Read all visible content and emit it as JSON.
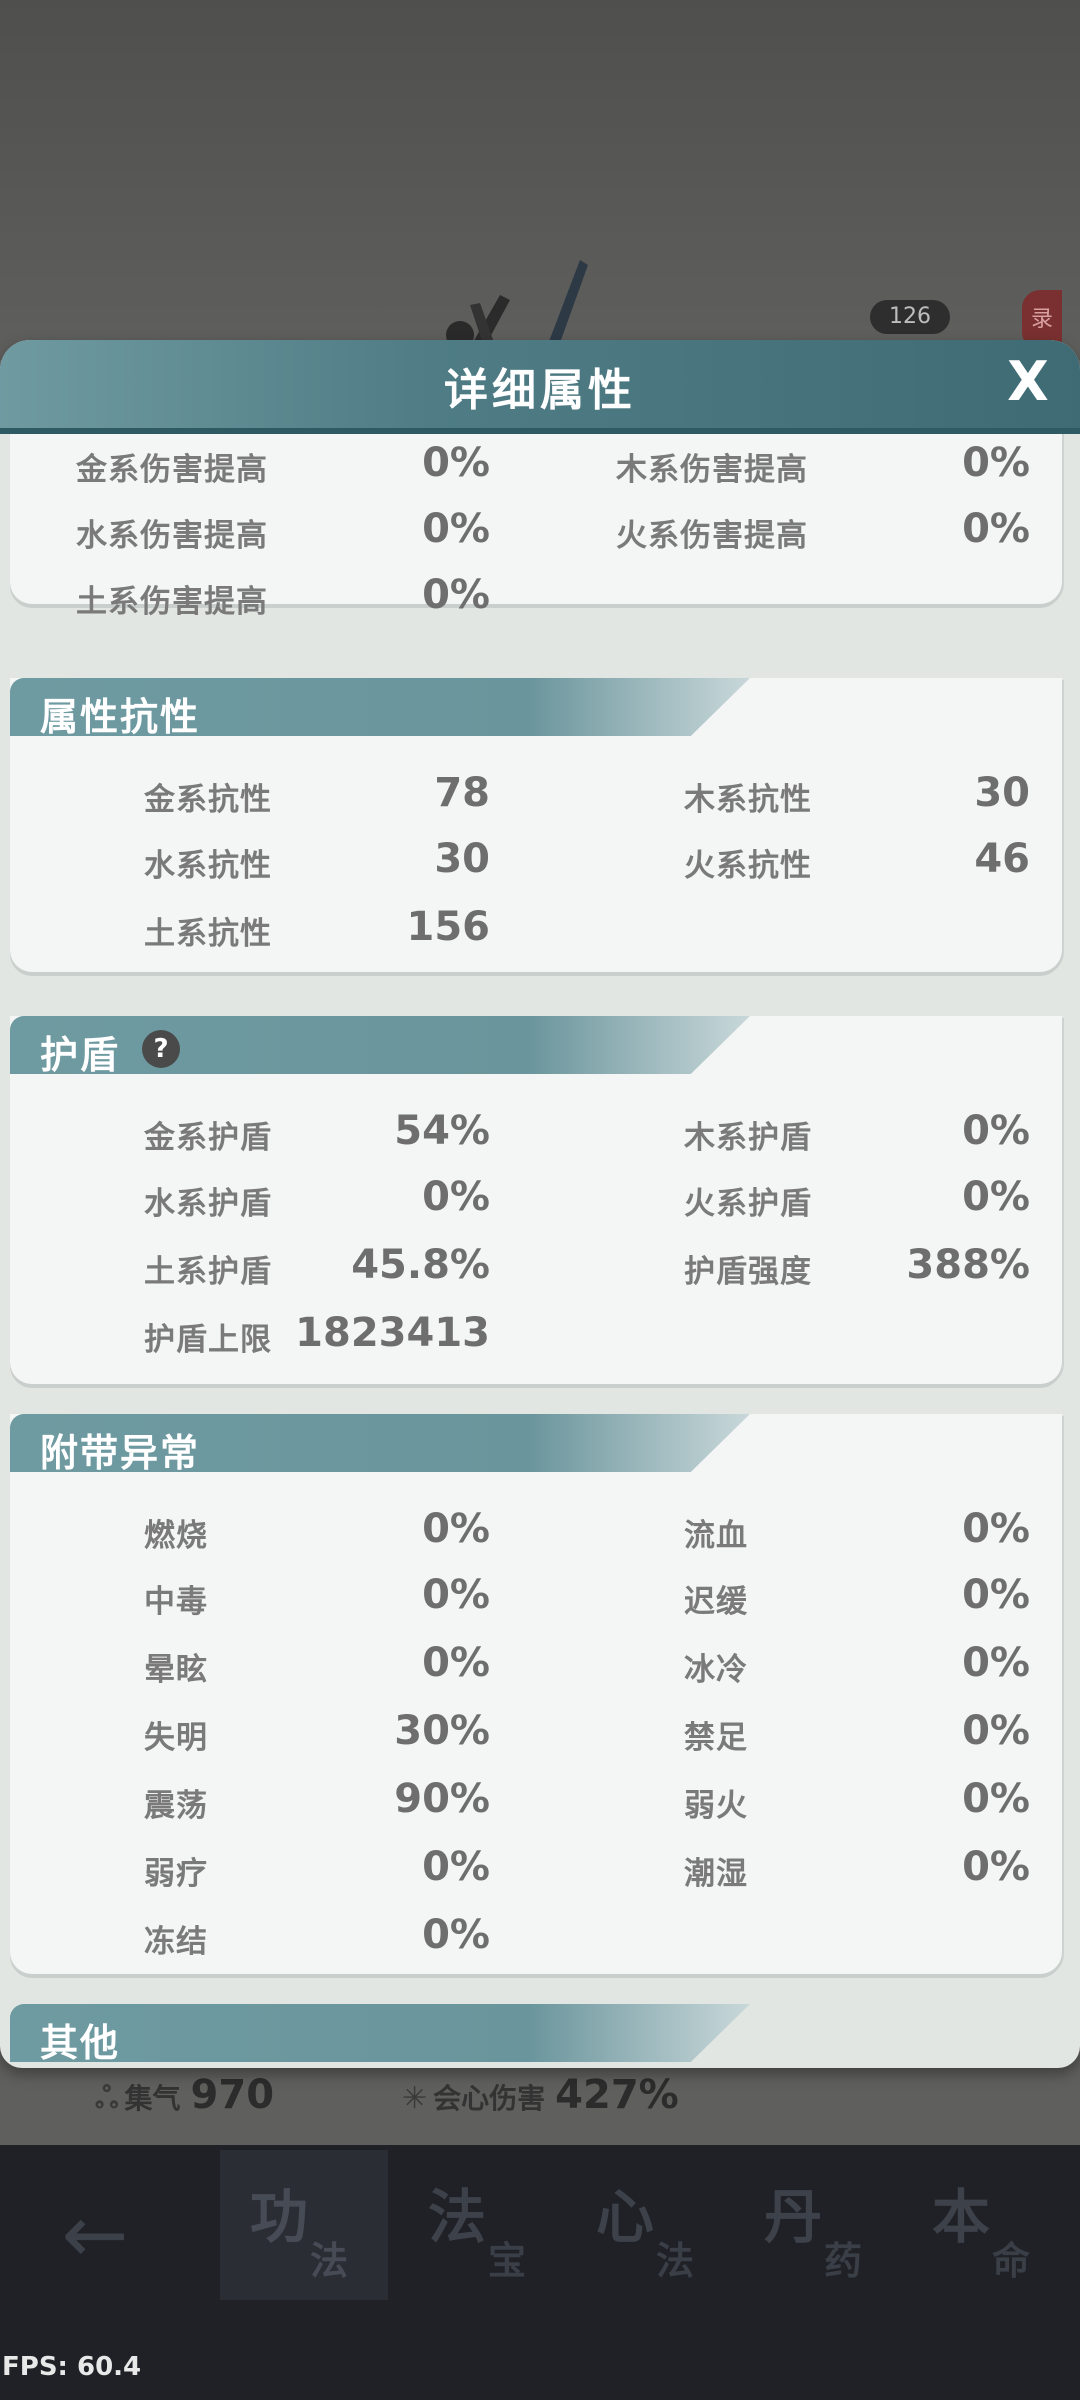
{
  "background": {
    "badge_number": "126",
    "side_tab": "录",
    "stats": [
      {
        "icon": "swirl-icon",
        "label": "集气",
        "value": "970"
      },
      {
        "icon": "crit-star-icon",
        "label": "会心伤害",
        "value": "427%"
      }
    ],
    "nav_tabs": [
      {
        "big": "功",
        "small": "法"
      },
      {
        "big": "法",
        "small": "宝"
      },
      {
        "big": "心",
        "small": "法"
      },
      {
        "big": "丹",
        "small": "药"
      },
      {
        "big": "本",
        "small": "命"
      }
    ],
    "fps": "FPS: 60.4"
  },
  "dialog": {
    "title": "详细属性",
    "close_label": "X",
    "damage_boost": [
      {
        "label": "金系伤害提高",
        "value": "0%"
      },
      {
        "label": "木系伤害提高",
        "value": "0%"
      },
      {
        "label": "水系伤害提高",
        "value": "0%"
      },
      {
        "label": "火系伤害提高",
        "value": "0%"
      },
      {
        "label": "土系伤害提高",
        "value": "0%"
      }
    ],
    "resistance": {
      "title": "属性抗性",
      "items": [
        {
          "label": "金系抗性",
          "value": "78"
        },
        {
          "label": "木系抗性",
          "value": "30"
        },
        {
          "label": "水系抗性",
          "value": "30"
        },
        {
          "label": "火系抗性",
          "value": "46"
        },
        {
          "label": "土系抗性",
          "value": "156"
        }
      ]
    },
    "shield": {
      "title": "护盾",
      "help": "?",
      "items": [
        {
          "label": "金系护盾",
          "value": "54%"
        },
        {
          "label": "木系护盾",
          "value": "0%"
        },
        {
          "label": "水系护盾",
          "value": "0%"
        },
        {
          "label": "火系护盾",
          "value": "0%"
        },
        {
          "label": "土系护盾",
          "value": "45.8%"
        },
        {
          "label": "护盾强度",
          "value": "388%"
        },
        {
          "label": "护盾上限",
          "value": "1823413"
        }
      ]
    },
    "abnormal": {
      "title": "附带异常",
      "items": [
        {
          "label": "燃烧",
          "value": "0%"
        },
        {
          "label": "流血",
          "value": "0%"
        },
        {
          "label": "中毒",
          "value": "0%"
        },
        {
          "label": "迟缓",
          "value": "0%"
        },
        {
          "label": "晕眩",
          "value": "0%"
        },
        {
          "label": "冰冷",
          "value": "0%"
        },
        {
          "label": "失明",
          "value": "30%"
        },
        {
          "label": "禁足",
          "value": "0%"
        },
        {
          "label": "震荡",
          "value": "90%"
        },
        {
          "label": "弱火",
          "value": "0%"
        },
        {
          "label": "弱疗",
          "value": "0%"
        },
        {
          "label": "潮湿",
          "value": "0%"
        },
        {
          "label": "冻结",
          "value": "0%"
        }
      ]
    },
    "other": {
      "title": "其他"
    }
  }
}
